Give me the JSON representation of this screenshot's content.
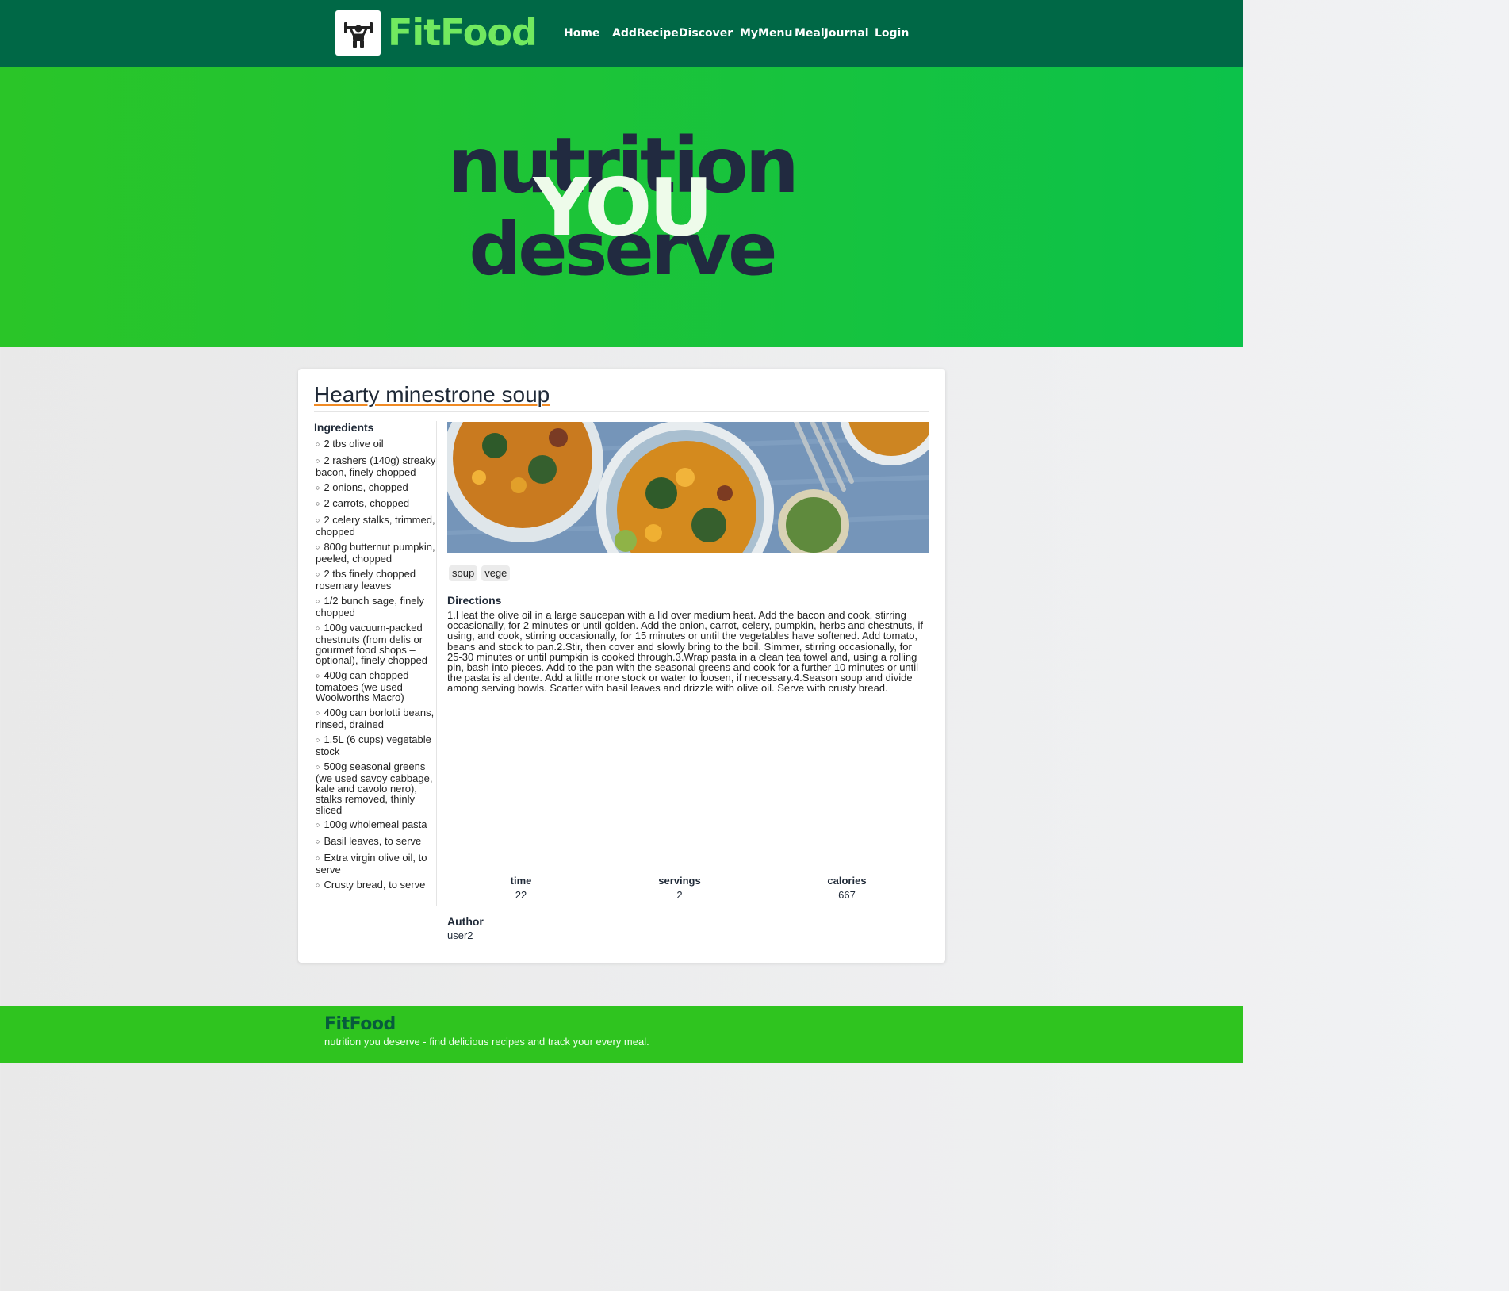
{
  "nav": {
    "brand": "FitFood",
    "logo_icon": "weightlifter-icon",
    "links": [
      "Home",
      "AddRecipe",
      "Discover",
      "MyMenu",
      "MealJournal",
      "Login"
    ]
  },
  "hero": {
    "line1": "nutrition",
    "line2": "YOU",
    "line3": "deserve"
  },
  "recipe": {
    "title": "Hearty minestrone soup",
    "ingredients_heading": "Ingredients",
    "ingredients": [
      "2 tbs olive oil",
      "2 rashers (140g) streaky bacon, finely chopped",
      "2 onions, chopped",
      "2 carrots, chopped",
      "2 celery stalks, trimmed, chopped",
      "800g butternut pumpkin, peeled, chopped",
      "2 tbs finely chopped rosemary leaves",
      "1/2 bunch sage, finely chopped",
      "100g vacuum-packed chestnuts (from delis or gourmet food shops – optional), finely chopped",
      "400g can chopped tomatoes (we used Woolworths Macro)",
      "400g can borlotti beans, rinsed, drained",
      "1.5L (6 cups) vegetable stock",
      "500g seasonal greens (we used savoy cabbage, kale and cavolo nero), stalks removed, thinly sliced",
      "100g wholemeal pasta",
      "Basil leaves, to serve",
      "Extra virgin olive oil, to serve",
      "Crusty bread, to serve"
    ],
    "tags": [
      "soup",
      "vege"
    ],
    "directions_heading": "Directions",
    "directions": "1.Heat the olive oil in a large saucepan with a lid over medium heat. Add the bacon and cook, stirring occasionally, for 2 minutes or until golden. Add the onion, carrot, celery, pumpkin, herbs and chestnuts, if using, and cook, stirring occasionally, for 15 minutes or until the vegetables have softened. Add tomato, beans and stock to pan.2.Stir, then cover and slowly bring to the boil. Simmer, stirring occasionally, for 25-30 minutes or until pumpkin is cooked through.3.Wrap pasta in a clean tea towel and, using a rolling pin, bash into pieces. Add to the pan with the seasonal greens and cook for a further 10 minutes or until the pasta is al dente. Add a little more stock or water to loosen, if necessary.4.Season soup and divide among serving bowls. Scatter with basil leaves and drizzle with olive oil. Serve with crusty bread.",
    "stats": [
      {
        "label": "time",
        "value": "22"
      },
      {
        "label": "servings",
        "value": "2"
      },
      {
        "label": "calories",
        "value": "667"
      }
    ],
    "author_heading": "Author",
    "author": "user2"
  },
  "footer": {
    "brand": "FitFood",
    "tagline": "nutrition you deserve - find delicious recipes and track your every meal."
  },
  "colors": {
    "nav_bg": "#006846",
    "brand_green": "#72e95f",
    "hero_green": "#1bc43a",
    "hero_text": "#212a40",
    "title_underline": "#f08a24",
    "footer_bg": "#2fc41f"
  }
}
